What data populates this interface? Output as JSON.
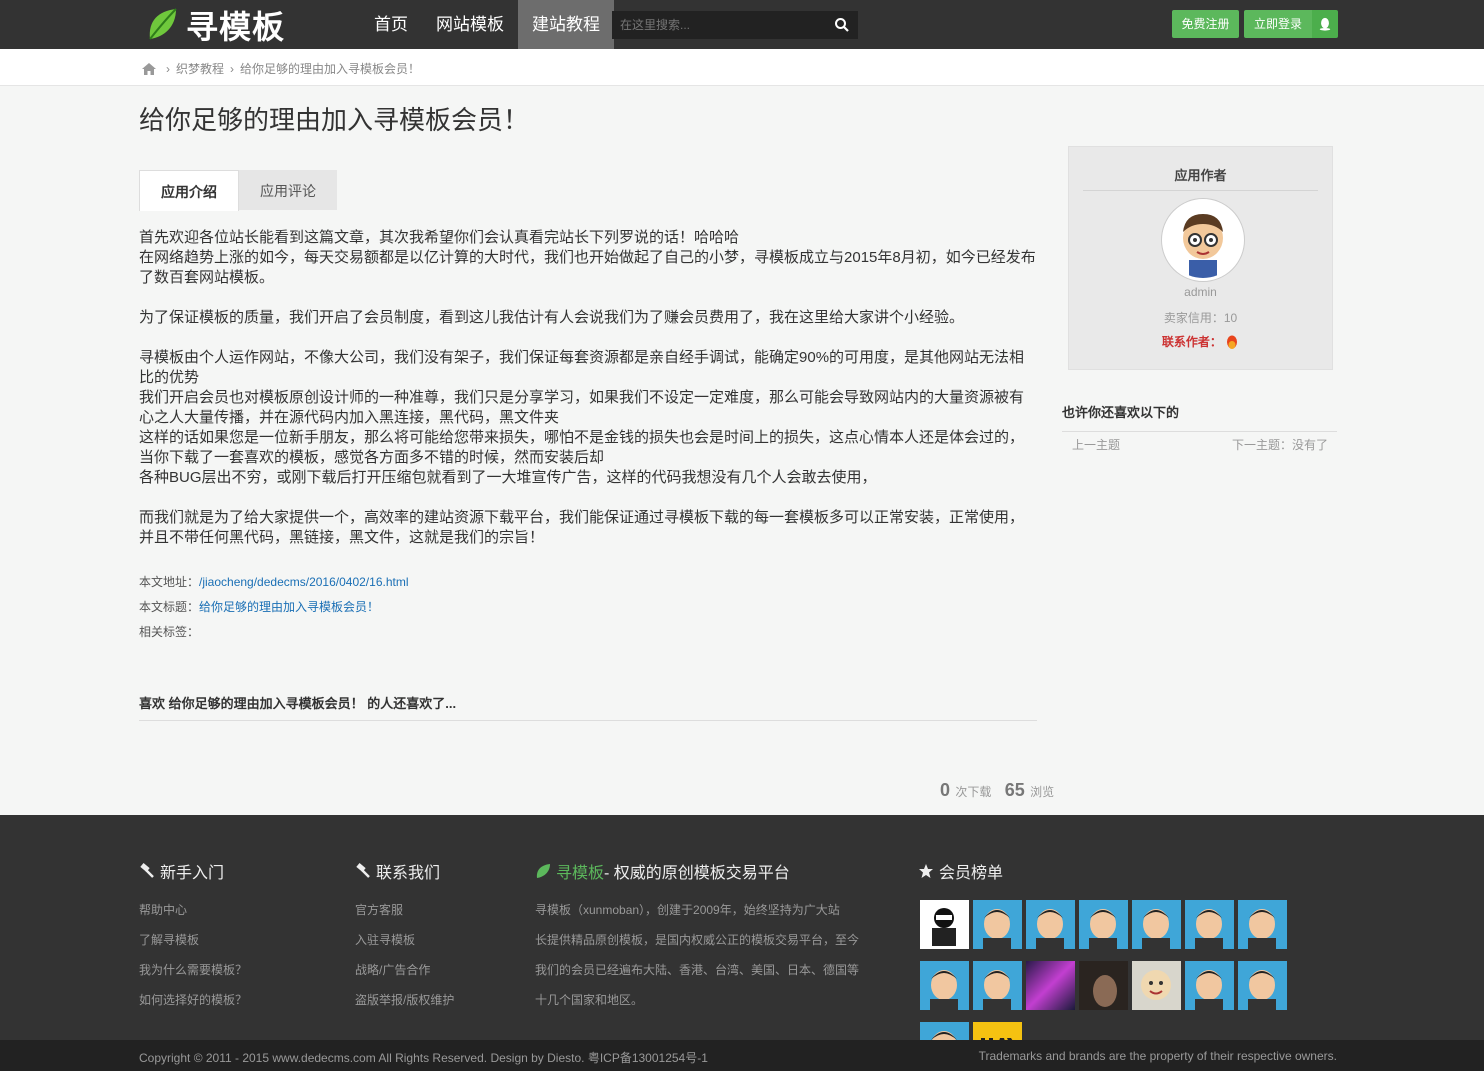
{
  "header": {
    "logo_text": "寻模板",
    "nav": [
      "首页",
      "网站模板",
      "建站教程"
    ],
    "active_nav": "建站教程",
    "search_placeholder": "在这里搜索...",
    "register_label": "免费注册",
    "login_label": "立即登录",
    "qq_icon": "qq-penguin-icon"
  },
  "breadcrumb": {
    "home_icon": "home-icon",
    "items": [
      "织梦教程",
      "给你足够的理由加入寻模板会员！"
    ]
  },
  "page_title": "给你足够的理由加入寻模板会员！",
  "tabs": [
    "应用介绍",
    "应用评论"
  ],
  "article": {
    "p1": "首先欢迎各位站长能看到这篇文章，其次我希望你们会认真看完站长下列罗说的话！哈哈哈",
    "p2": "在网络趋势上涨的如今，每天交易额都是以亿计算的大时代，我们也开始做起了自己的小梦，寻模板成立与2015年8月初，如今已经发布了数百套网站模板。",
    "p3": "为了保证模板的质量，我们开启了会员制度，看到这儿我估计有人会说我们为了赚会员费用了，我在这里给大家讲个小经验。",
    "p4": "寻模板由个人运作网站，不像大公司，我们没有架子，我们保证每套资源都是亲自经手调试，能确定90%的可用度，是其他网站无法相比的优势",
    "p5": "我们开启会员也对模板原创设计师的一种准尊，我们只是分享学习，如果我们不设定一定难度，那么可能会导致网站内的大量资源被有心之人大量传播，并在源代码内加入黑连接，黑代码，黑文件夹",
    "p6": "这样的话如果您是一位新手朋友，那么将可能给您带来损失，哪怕不是金钱的损失也会是时间上的损失，这点心情本人还是体会过的，当你下载了一套喜欢的模板，感觉各方面多不错的时候，然而安装后却",
    "p7": "各种BUG层出不穷，或刚下载后打开压缩包就看到了一大堆宣传广告，这样的代码我想没有几个人会敢去使用，",
    "p8": "而我们就是为了给大家提供一个，高效率的建站资源下载平台，我们能保证通过寻模板下载的每一套模板多可以正常安装，正常使用，并且不带任何黑代码，黑链接，黑文件，这就是我们的宗旨！"
  },
  "meta": {
    "url_label": "本文地址：",
    "url": "/jiaocheng/dedecms/2016/0402/16.html",
    "title_label": "本文标题：",
    "title": "给你足够的理由加入寻模板会员！",
    "tags_label": "相关标签："
  },
  "like_heading": "喜欢 给你足够的理由加入寻模板会员！ 的人还喜欢了...",
  "stats": {
    "downloads": "0",
    "downloads_label": "次下载",
    "views": "65",
    "views_label": "浏览"
  },
  "author": {
    "heading": "应用作者",
    "name": "admin",
    "credit": "卖家信用：10",
    "contact_label": "联系作者："
  },
  "maybe": {
    "heading": "也许你还喜欢以下的",
    "prev": "上一主题",
    "next": "下一主题：没有了"
  },
  "footer": {
    "col1": {
      "heading": "新手入门",
      "links": [
        "帮助中心",
        "了解寻模板",
        "我为什么需要模板？",
        "如何选择好的模板？"
      ]
    },
    "col2": {
      "heading": "联系我们",
      "links": [
        "官方客服",
        "入驻寻模板",
        "战略/广告合作",
        "盗版举报/版权维护"
      ]
    },
    "col3": {
      "brand": "寻模板",
      "heading_rest": " - 权威的原创模板交易平台",
      "lines": [
        "寻模板（xunmoban），创建于2009年，始终坚持为广大站",
        "长提供精品原创模板，是国内权威公正的模板交易平台，至今",
        "我们的会员已经遍布大陆、香港、台湾、美国、日本、德国等",
        "十几个国家和地区。"
      ]
    },
    "col4": {
      "heading": "会员榜单"
    },
    "copyright": "Copyright © 2011 - 2015 www.dedecms.com All Rights Reserved. Design by Diesto. 粤ICP备13001254号-1",
    "trademark": "Trademarks and brands are the property of their respective owners."
  },
  "colors": {
    "topbar": "#333333",
    "green": "#5cb85c",
    "link": "#1a6fb5"
  }
}
